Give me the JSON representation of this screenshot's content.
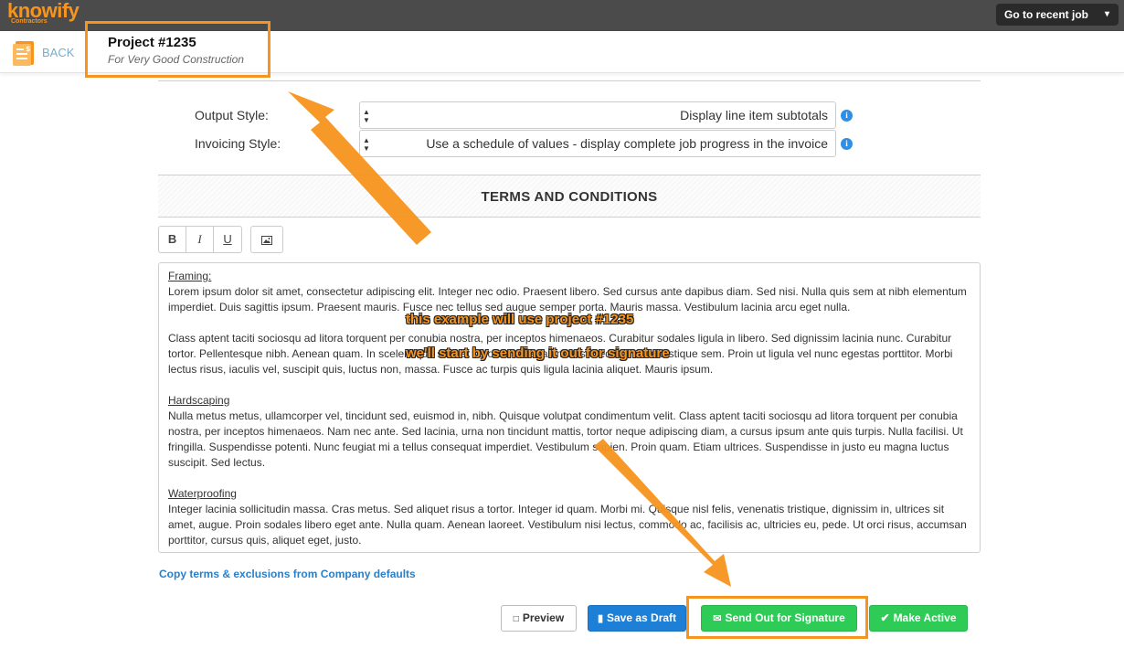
{
  "topbar": {
    "logo": "knowify",
    "logo_sub": "Contractors",
    "recent_job_label": "Go to recent job",
    "recent_job_chevron": "▾"
  },
  "header": {
    "back_label": "BACK",
    "project_title": "Project #1235",
    "project_subtitle": "For Very Good Construction"
  },
  "fields": [
    {
      "label": "Output Style:",
      "value": "Display line item subtotals"
    },
    {
      "label": "Invoicing Style:",
      "value": "Use a schedule of values - display complete job progress in the invoice"
    }
  ],
  "terms": {
    "title": "TERMS AND CONDITIONS",
    "toolbar": {
      "bold": "B",
      "italic": "I",
      "underline": "U"
    },
    "sections": [
      {
        "heading": "Framing:",
        "paragraphs": [
          "Lorem ipsum dolor sit amet, consectetur adipiscing elit. Integer nec odio. Praesent libero. Sed cursus ante dapibus diam. Sed nisi. Nulla quis sem at nibh elementum imperdiet. Duis sagittis ipsum. Praesent mauris. Fusce nec tellus sed augue semper porta. Mauris massa. Vestibulum lacinia arcu eget nulla.",
          "Class aptent taciti sociosqu ad litora torquent per conubia nostra, per inceptos himenaeos. Curabitur sodales ligula in libero. Sed dignissim lacinia nunc. Curabitur tortor. Pellentesque nibh. Aenean quam. In scelerisque sem at dolor. Maecenas mattis. Sed convallis tristique sem. Proin ut ligula vel nunc egestas porttitor. Morbi lectus risus, iaculis vel, suscipit quis, luctus non, massa. Fusce ac turpis quis ligula lacinia aliquet. Mauris ipsum."
        ]
      },
      {
        "heading": "Hardscaping",
        "paragraphs": [
          "Nulla metus metus, ullamcorper vel, tincidunt sed, euismod in, nibh. Quisque volutpat condimentum velit. Class aptent taciti sociosqu ad litora torquent per conubia nostra, per inceptos himenaeos. Nam nec ante. Sed lacinia, urna non tincidunt mattis, tortor neque adipiscing diam, a cursus ipsum ante quis turpis. Nulla facilisi. Ut fringilla. Suspendisse potenti. Nunc feugiat mi a tellus consequat imperdiet. Vestibulum sapien. Proin quam. Etiam ultrices. Suspendisse in justo eu magna luctus suscipit. Sed lectus."
        ]
      },
      {
        "heading": "Waterproofing",
        "paragraphs": [
          "Integer lacinia sollicitudin massa. Cras metus. Sed aliquet risus a tortor. Integer id quam. Morbi mi. Quisque nisl felis, venenatis tristique, dignissim in, ultrices sit amet, augue. Proin sodales libero eget ante. Nulla quam. Aenean laoreet. Vestibulum nisi lectus, commodo ac, facilisis ac, ultricies eu, pede. Ut orci risus, accumsan porttitor, cursus quis, aliquet eget, justo."
        ]
      }
    ],
    "copy_link": "Copy terms & exclusions from Company defaults"
  },
  "actions": {
    "preview": "Preview",
    "save_draft": "Save as Draft",
    "send_signature": "Send Out for Signature",
    "make_active": "Make Active"
  },
  "annotations": {
    "caption_1": "this example will use project #1235",
    "caption_2": "we'll start by sending it out for signature",
    "highlight_color": "#f7941d"
  },
  "colors": {
    "accent_orange": "#f7941d",
    "primary_blue": "#1e7fd6",
    "success_green": "#2ecc57",
    "link_blue": "#2a7fc9",
    "topbar_bg": "#4b4b4b"
  }
}
